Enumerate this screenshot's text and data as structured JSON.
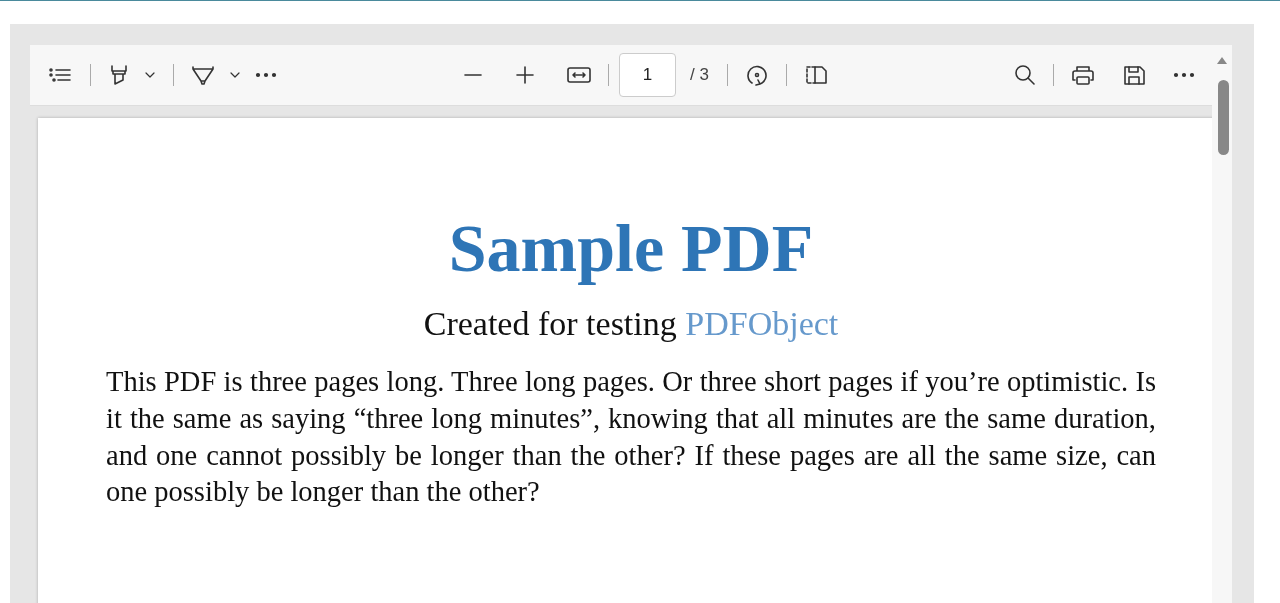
{
  "toolbar": {
    "page_number": "1",
    "page_count": "/ 3"
  },
  "document": {
    "title": "Sample PDF",
    "subtitle": "Created for testing",
    "subtitle_link": "PDFObject",
    "paragraph": "This PDF is three pages long. Three long pages. Or three short pages if you’re optimistic. Is it the same as saying “three long minutes”, knowing that all minutes are the same duration, and one cannot possibly be longer than the other? If these pages are all the same size, can one possibly be longer than the other?"
  }
}
